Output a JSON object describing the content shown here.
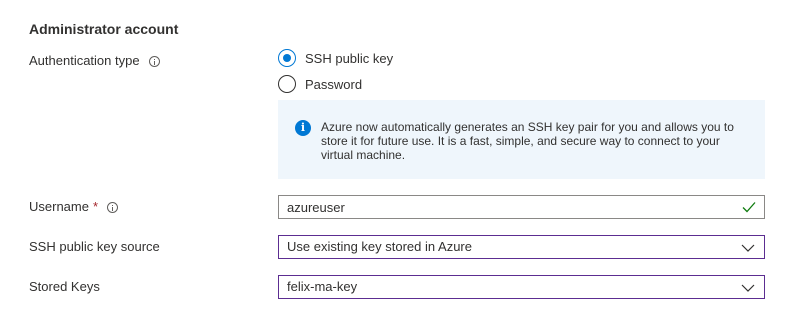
{
  "section": {
    "title": "Administrator account"
  },
  "auth": {
    "label": "Authentication type",
    "options": [
      {
        "label": "SSH public key",
        "checked": true
      },
      {
        "label": "Password",
        "checked": false
      }
    ],
    "info_text": "Azure now automatically generates an SSH key pair for you and allows you to store it for future use. It is a fast, simple, and secure way to connect to your virtual machine.",
    "info_icon": "info-icon"
  },
  "username": {
    "label": "Username",
    "required_marker": "*",
    "value": "azureuser",
    "valid": true
  },
  "ssh_source": {
    "label": "SSH public key source",
    "selected": "Use existing key stored in Azure"
  },
  "stored_keys": {
    "label": "Stored Keys",
    "selected": "felix-ma-key"
  },
  "colors": {
    "accent": "#0078d4",
    "focus_border": "#5c2d91",
    "valid_check": "#107c10",
    "required": "#a4262c",
    "info_background": "#eff6fc"
  }
}
